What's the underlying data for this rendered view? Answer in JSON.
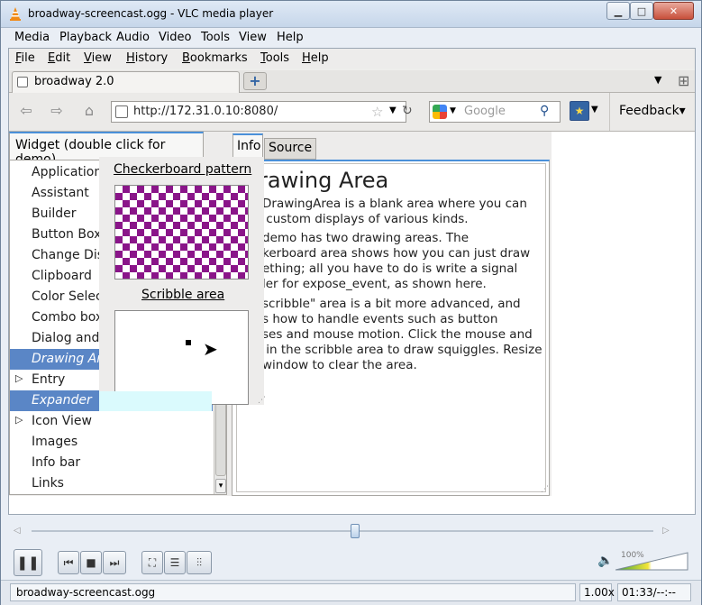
{
  "window": {
    "title": "broadway-screencast.ogg - VLC media player",
    "menus": [
      "Media",
      "Playback",
      "Audio",
      "Video",
      "Tools",
      "View",
      "Help"
    ]
  },
  "firefox": {
    "menus": [
      "File",
      "Edit",
      "View",
      "History",
      "Bookmarks",
      "Tools",
      "Help"
    ],
    "tab_title": "broadway 2.0",
    "url": "http://172.31.0.10:8080/",
    "search_placeholder": "Google",
    "feedback_label": "Feedback"
  },
  "gtk_demo": {
    "left_tab": "Widget (double click for demo)",
    "items": [
      {
        "label": "Application m",
        "expander": false,
        "selected": false
      },
      {
        "label": "Assistant",
        "expander": false,
        "selected": false
      },
      {
        "label": "Builder",
        "expander": false,
        "selected": false
      },
      {
        "label": "Button Boxe",
        "expander": false,
        "selected": false
      },
      {
        "label": "Change Displ",
        "expander": false,
        "selected": false
      },
      {
        "label": "Clipboard",
        "expander": false,
        "selected": false
      },
      {
        "label": "Color Selec",
        "expander": false,
        "selected": false
      },
      {
        "label": "Combo boxes",
        "expander": false,
        "selected": false
      },
      {
        "label": "Dialog and M",
        "expander": false,
        "selected": false
      },
      {
        "label": "Drawing Are",
        "expander": false,
        "selected": true
      },
      {
        "label": "Entry",
        "expander": true,
        "selected": false
      },
      {
        "label": "Expander",
        "expander": false,
        "selected": true
      },
      {
        "label": "Icon View",
        "expander": true,
        "selected": false
      },
      {
        "label": "Images",
        "expander": false,
        "selected": false
      },
      {
        "label": "Info bar",
        "expander": false,
        "selected": false
      },
      {
        "label": "Links",
        "expander": false,
        "selected": false
      }
    ],
    "tab_info": "Info",
    "tab_source": "Source",
    "heading": "rawing Area",
    "paragraphs": [
      "DrawingArea is a blank area where you can\n custom displays of various kinds.",
      "demo has two drawing areas. The\nkerboard area shows how you can just draw\nething; all you have to do is write a signal\nler for expose_event, as shown here.",
      "scribble\" area is a bit more advanced, and\ns how to handle events such as button\nses and mouse motion. Click the mouse and\n in the scribble area to draw squiggles. Resize\nwindow to clear the area."
    ],
    "demo_checker_label": "Checkerboard pattern",
    "demo_scribble_label": "Scribble area"
  },
  "player": {
    "volume_label": "100%",
    "status_file": "broadway-screencast.ogg",
    "status_rate": "1.00x",
    "status_time": "01:33/--:--"
  }
}
